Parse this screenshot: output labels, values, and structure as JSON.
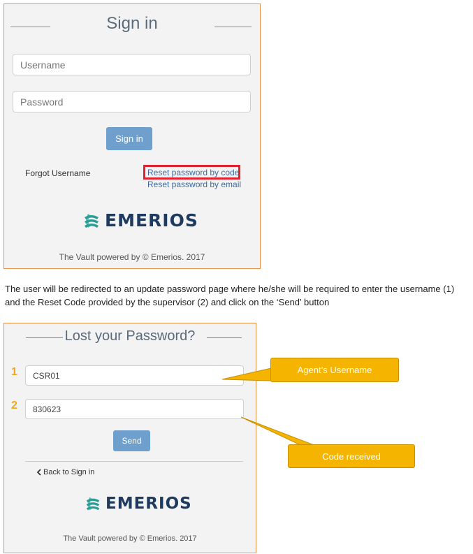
{
  "signin_panel": {
    "title": "Sign in",
    "username_placeholder": "Username",
    "password_placeholder": "Password",
    "signin_button": "Sign in",
    "forgot_username": "Forgot Username",
    "reset_by_code": "Reset password by code",
    "reset_by_email": "Reset password by email",
    "logo_text": "EMERIOS",
    "footer": "The Vault powered by © Emerios. 2017"
  },
  "instruction_text": "The user will be redirected to an update password page where he/she will be required to enter the username (1) and the Reset Code provided by the supervisor (2) and click on the ‘Send’ button",
  "lost_panel": {
    "title": "Lost your Password?",
    "step1_number": "1",
    "step2_number": "2",
    "username_value": "CSR01",
    "code_value": "830623",
    "send_button": "Send",
    "back_link": "Back to Sign in",
    "logo_text": "EMERIOS",
    "footer": "The Vault powered by © Emerios. 2017"
  },
  "callouts": {
    "username": "Agent’s Username",
    "code": "Code received"
  },
  "colors": {
    "panel_border": "#e8914a",
    "button": "#6f9fcd",
    "highlight_box": "#e0232e",
    "callout": "#f5b400",
    "step_number": "#f0a818",
    "logo": "#1e3a5f"
  },
  "icons": {
    "logo_mark": "emerios-swirl-icon",
    "back": "chevron-left-icon"
  }
}
